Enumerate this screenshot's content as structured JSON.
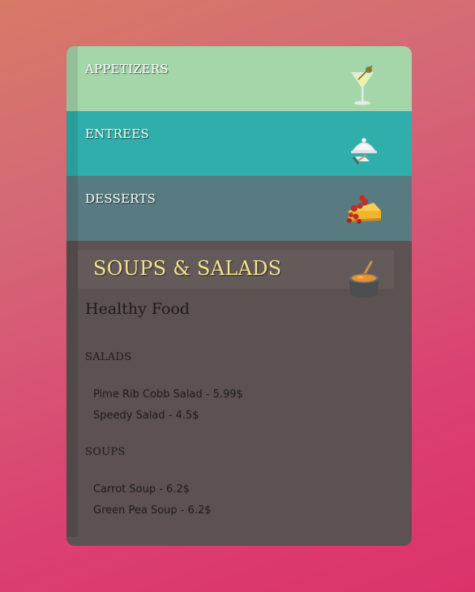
{
  "menu": {
    "tabs": [
      {
        "label": "APPETIZERS",
        "icon": "cocktail-icon"
      },
      {
        "label": "ENTREES",
        "icon": "food-cloche-icon"
      },
      {
        "label": "DESSERTS",
        "icon": "cheesecake-icon"
      }
    ],
    "active": {
      "title": "SOUPS & SALADS",
      "icon": "soup-pot-icon",
      "subtitle": "Healthy Food",
      "sections": [
        {
          "heading": "SALADS",
          "items": [
            "Pime Rib Cobb Salad - 5.99$",
            "Speedy Salad - 4.5$"
          ]
        },
        {
          "heading": "SOUPS",
          "items": [
            "Carrot Soup - 6.2$",
            "Green Pea Soup - 6.2$"
          ]
        }
      ]
    }
  },
  "colors": {
    "appetizers_bg": "#a4d6aa",
    "entrees_bg": "#2faeab",
    "desserts_bg": "#577b80",
    "panel_bg": "#5b5251",
    "title_color": "#f6e58c"
  }
}
